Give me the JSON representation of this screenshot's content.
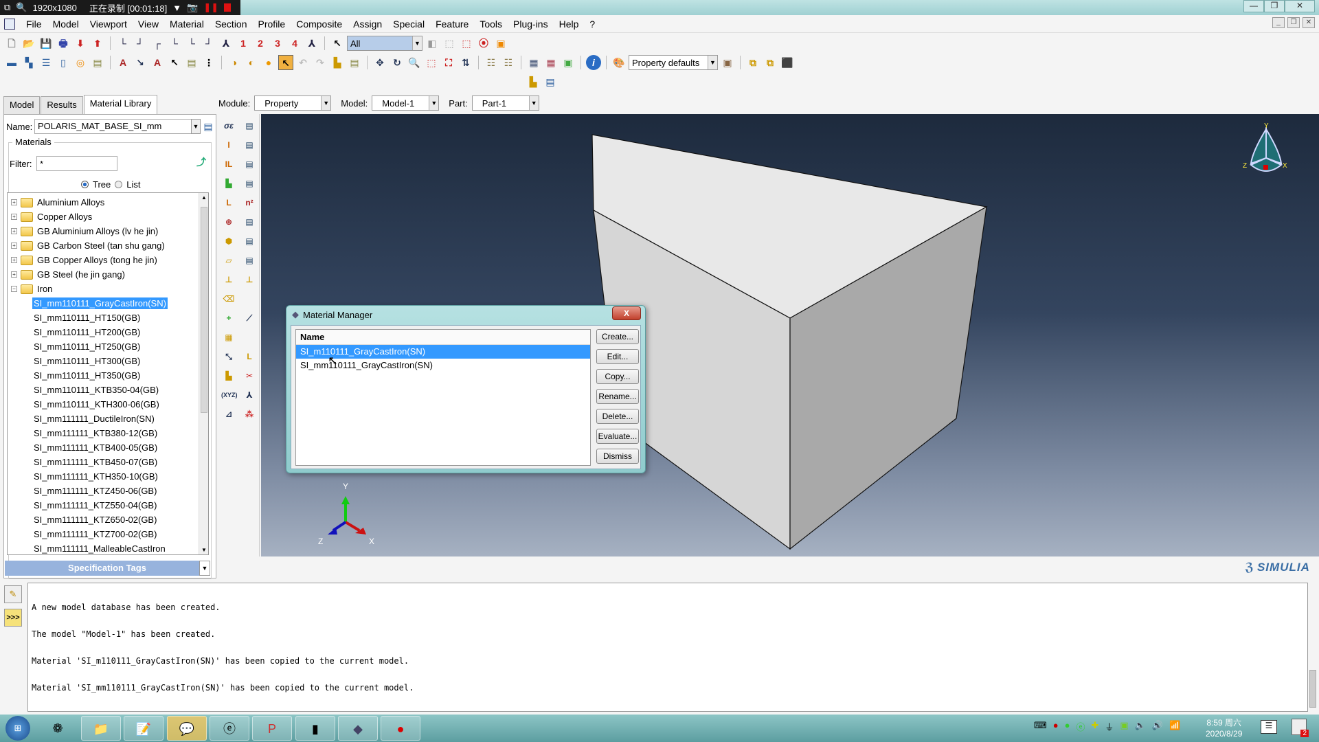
{
  "recorder": {
    "resolution": "1920x1080",
    "status": "正在录制 [00:01:18]"
  },
  "menu": [
    {
      "label": "File"
    },
    {
      "label": "Model"
    },
    {
      "label": "Viewport"
    },
    {
      "label": "View"
    },
    {
      "label": "Material"
    },
    {
      "label": "Section"
    },
    {
      "label": "Profile"
    },
    {
      "label": "Composite"
    },
    {
      "label": "Assign"
    },
    {
      "label": "Special"
    },
    {
      "label": "Feature"
    },
    {
      "label": "Tools"
    },
    {
      "label": "Plug-ins"
    },
    {
      "label": "Help"
    },
    {
      "label": "?"
    }
  ],
  "toolbar": {
    "view_numbers": [
      "1",
      "2",
      "3",
      "4"
    ],
    "selection_filter": "All",
    "render_style": "Property defaults"
  },
  "left_tabs": [
    {
      "label": "Model"
    },
    {
      "label": "Results"
    },
    {
      "label": "Material Library"
    }
  ],
  "library": {
    "name_label": "Name:",
    "name_value": "POLARIS_MAT_BASE_SI_mm",
    "materials_label": "Materials",
    "filter_label": "Filter:",
    "filter_value": "*",
    "tree_label": "Tree",
    "list_label": "List",
    "view_mode": "Tree",
    "folders": [
      {
        "label": "Aluminium Alloys"
      },
      {
        "label": "Copper Alloys"
      },
      {
        "label": "GB Aluminium Alloys (lv he jin)"
      },
      {
        "label": "GB Carbon Steel (tan shu gang)"
      },
      {
        "label": "GB Copper Alloys (tong he jin)"
      },
      {
        "label": "GB Steel (he jin gang)"
      },
      {
        "label": "Iron"
      }
    ],
    "iron_items": [
      {
        "label": "SI_mm110111_GrayCastIron(SN)",
        "selected": true
      },
      {
        "label": "SI_mm110111_HT150(GB)"
      },
      {
        "label": "SI_mm110111_HT200(GB)"
      },
      {
        "label": "SI_mm110111_HT250(GB)"
      },
      {
        "label": "SI_mm110111_HT300(GB)"
      },
      {
        "label": "SI_mm110111_HT350(GB)"
      },
      {
        "label": "SI_mm110111_KTB350-04(GB)"
      },
      {
        "label": "SI_mm110111_KTH300-06(GB)"
      },
      {
        "label": "SI_mm111111_DuctileIron(SN)"
      },
      {
        "label": "SI_mm111111_KTB380-12(GB)"
      },
      {
        "label": "SI_mm111111_KTB400-05(GB)"
      },
      {
        "label": "SI_mm111111_KTB450-07(GB)"
      },
      {
        "label": "SI_mm111111_KTH350-10(GB)"
      },
      {
        "label": "SI_mm111111_KTZ450-06(GB)"
      },
      {
        "label": "SI_mm111111_KTZ550-04(GB)"
      },
      {
        "label": "SI_mm111111_KTZ650-02(GB)"
      },
      {
        "label": "SI_mm111111_KTZ700-02(GB)"
      },
      {
        "label": "SI_mm111111_MalleableCastIron"
      }
    ],
    "spec_tags": "Specification Tags"
  },
  "context": {
    "module_label": "Module:",
    "module_value": "Property",
    "model_label": "Model:",
    "model_value": "Model-1",
    "part_label": "Part:",
    "part_value": "Part-1"
  },
  "triad": {
    "x": "X",
    "y": "Y",
    "z": "Z"
  },
  "brand": "SIMULIA",
  "dialog": {
    "title": "Material Manager",
    "close": "X",
    "column": "Name",
    "rows": [
      {
        "label": "SI_m110111_GrayCastIron(SN)",
        "selected": true
      },
      {
        "label": "SI_mm110111_GrayCastIron(SN)"
      }
    ],
    "buttons": [
      {
        "label": "Create..."
      },
      {
        "label": "Edit..."
      },
      {
        "label": "Copy..."
      },
      {
        "label": "Rename..."
      },
      {
        "label": "Delete..."
      },
      {
        "label": "Evaluate..."
      },
      {
        "label": "Dismiss"
      }
    ]
  },
  "messages": [
    "A new model database has been created.",
    "The model \"Model-1\" has been created.",
    "Material 'SI_m110111_GrayCastIron(SN)' has been copied to the current model.",
    "Material 'SI_mm110111_GrayCastIron(SN)' has been copied to the current model."
  ],
  "taskbar": {
    "time": "8:59 周六",
    "date": "2020/8/29",
    "notification_count": "2"
  },
  "colors": {
    "selection": "#3399ff",
    "viewport_top": "#1d2a3d",
    "spec_tags": "#97b3dd"
  }
}
